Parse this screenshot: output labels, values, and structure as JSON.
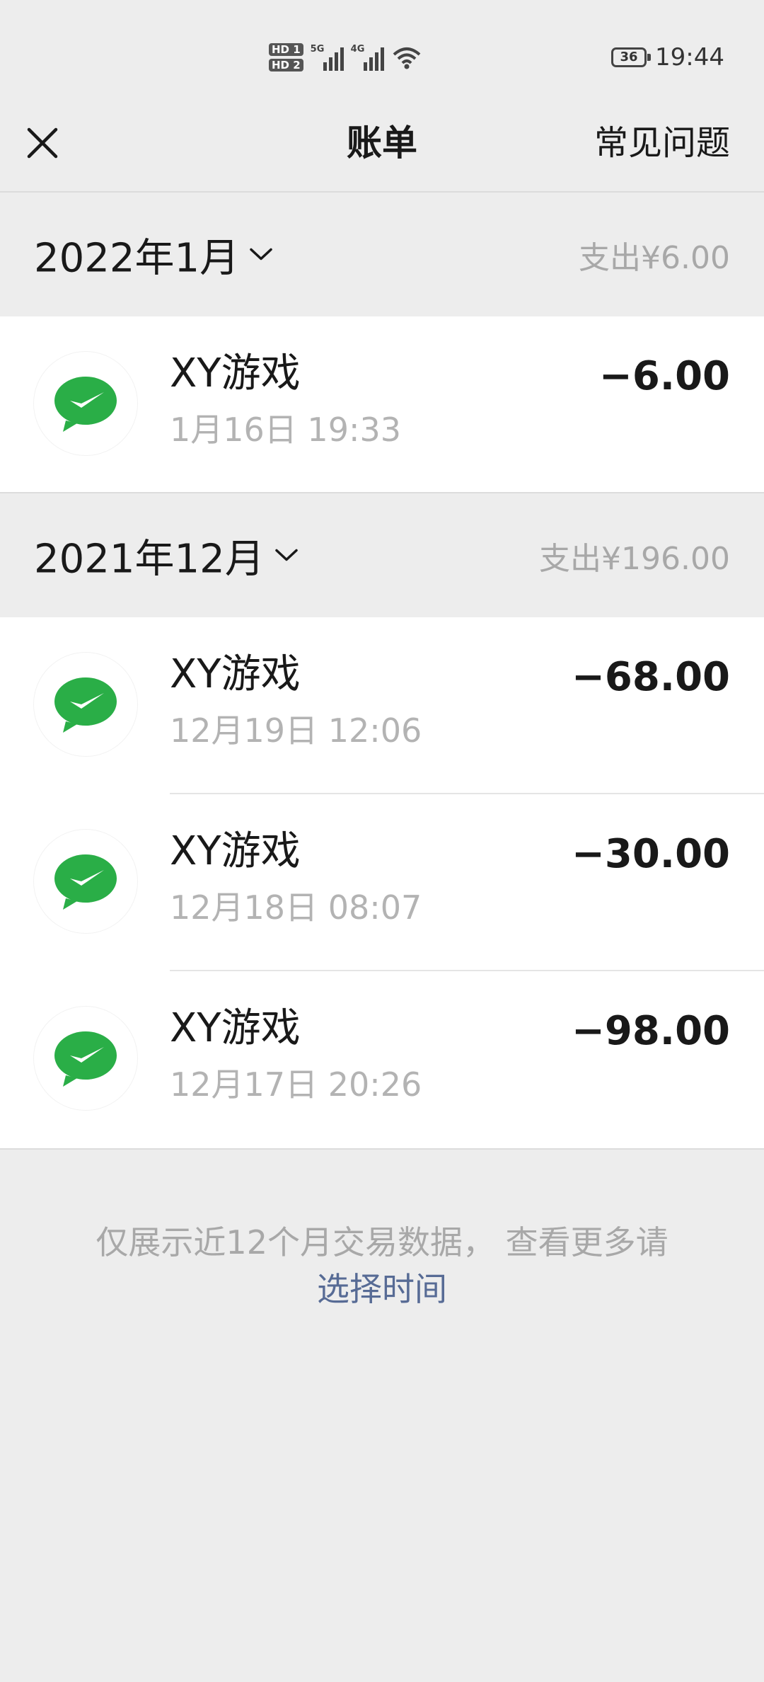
{
  "status_bar": {
    "sim1": "HD 1",
    "sim2": "HD 2",
    "net1": "5G",
    "net2": "4G",
    "battery": "36",
    "time": "19:44"
  },
  "nav": {
    "title": "账单",
    "faq": "常见问题"
  },
  "months": [
    {
      "label": "2022年1月",
      "total": "支出¥6.00",
      "items": [
        {
          "name": "XY游戏",
          "time": "1月16日 19:33",
          "amount": "−6.00"
        }
      ]
    },
    {
      "label": "2021年12月",
      "total": "支出¥196.00",
      "items": [
        {
          "name": "XY游戏",
          "time": "12月19日 12:06",
          "amount": "−68.00"
        },
        {
          "name": "XY游戏",
          "time": "12月18日 08:07",
          "amount": "−30.00"
        },
        {
          "name": "XY游戏",
          "time": "12月17日 20:26",
          "amount": "−98.00"
        }
      ]
    }
  ],
  "footer": {
    "note": "仅展示近12个月交易数据， 查看更多请",
    "link": "选择时间"
  },
  "colors": {
    "background": "#ededed",
    "wechat_green": "#2aae47",
    "link": "#576b95",
    "muted": "#a8a8a8"
  },
  "icons": {
    "close": "close-icon",
    "month_dropdown": "chevron-down-icon",
    "merchant": "wechat-pay-icon"
  }
}
